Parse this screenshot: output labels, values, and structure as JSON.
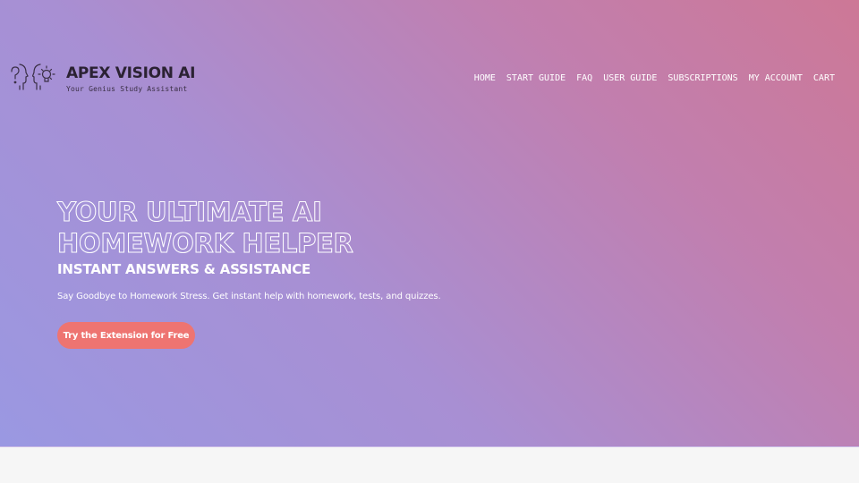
{
  "brand": {
    "name": "APEX VISION AI",
    "tagline": "Your Genius Study Assistant",
    "icons": [
      "question-head-icon",
      "lightbulb-head-icon"
    ]
  },
  "nav": {
    "items": [
      {
        "label": "HOME"
      },
      {
        "label": "START GUIDE"
      },
      {
        "label": "FAQ"
      },
      {
        "label": "USER GUIDE"
      },
      {
        "label": "SUBSCRIPTIONS"
      },
      {
        "label": "MY ACCOUNT"
      },
      {
        "label": "CART"
      }
    ]
  },
  "hero": {
    "title_line1": "YOUR ULTIMATE AI",
    "title_line2": "HOMEWORK HELPER",
    "subtitle": "INSTANT ANSWERS & ASSISTANCE",
    "description": "Say Goodbye to Homework Stress. Get instant help with homework, tests, and quizzes.",
    "cta_label": "Try the Extension for Free"
  },
  "colors": {
    "gradient_start": "#9a98e2",
    "gradient_end": "#cd7896",
    "cta": "#ee7471",
    "lower_background": "#f6f6f6",
    "brand_text": "#2b2233"
  }
}
